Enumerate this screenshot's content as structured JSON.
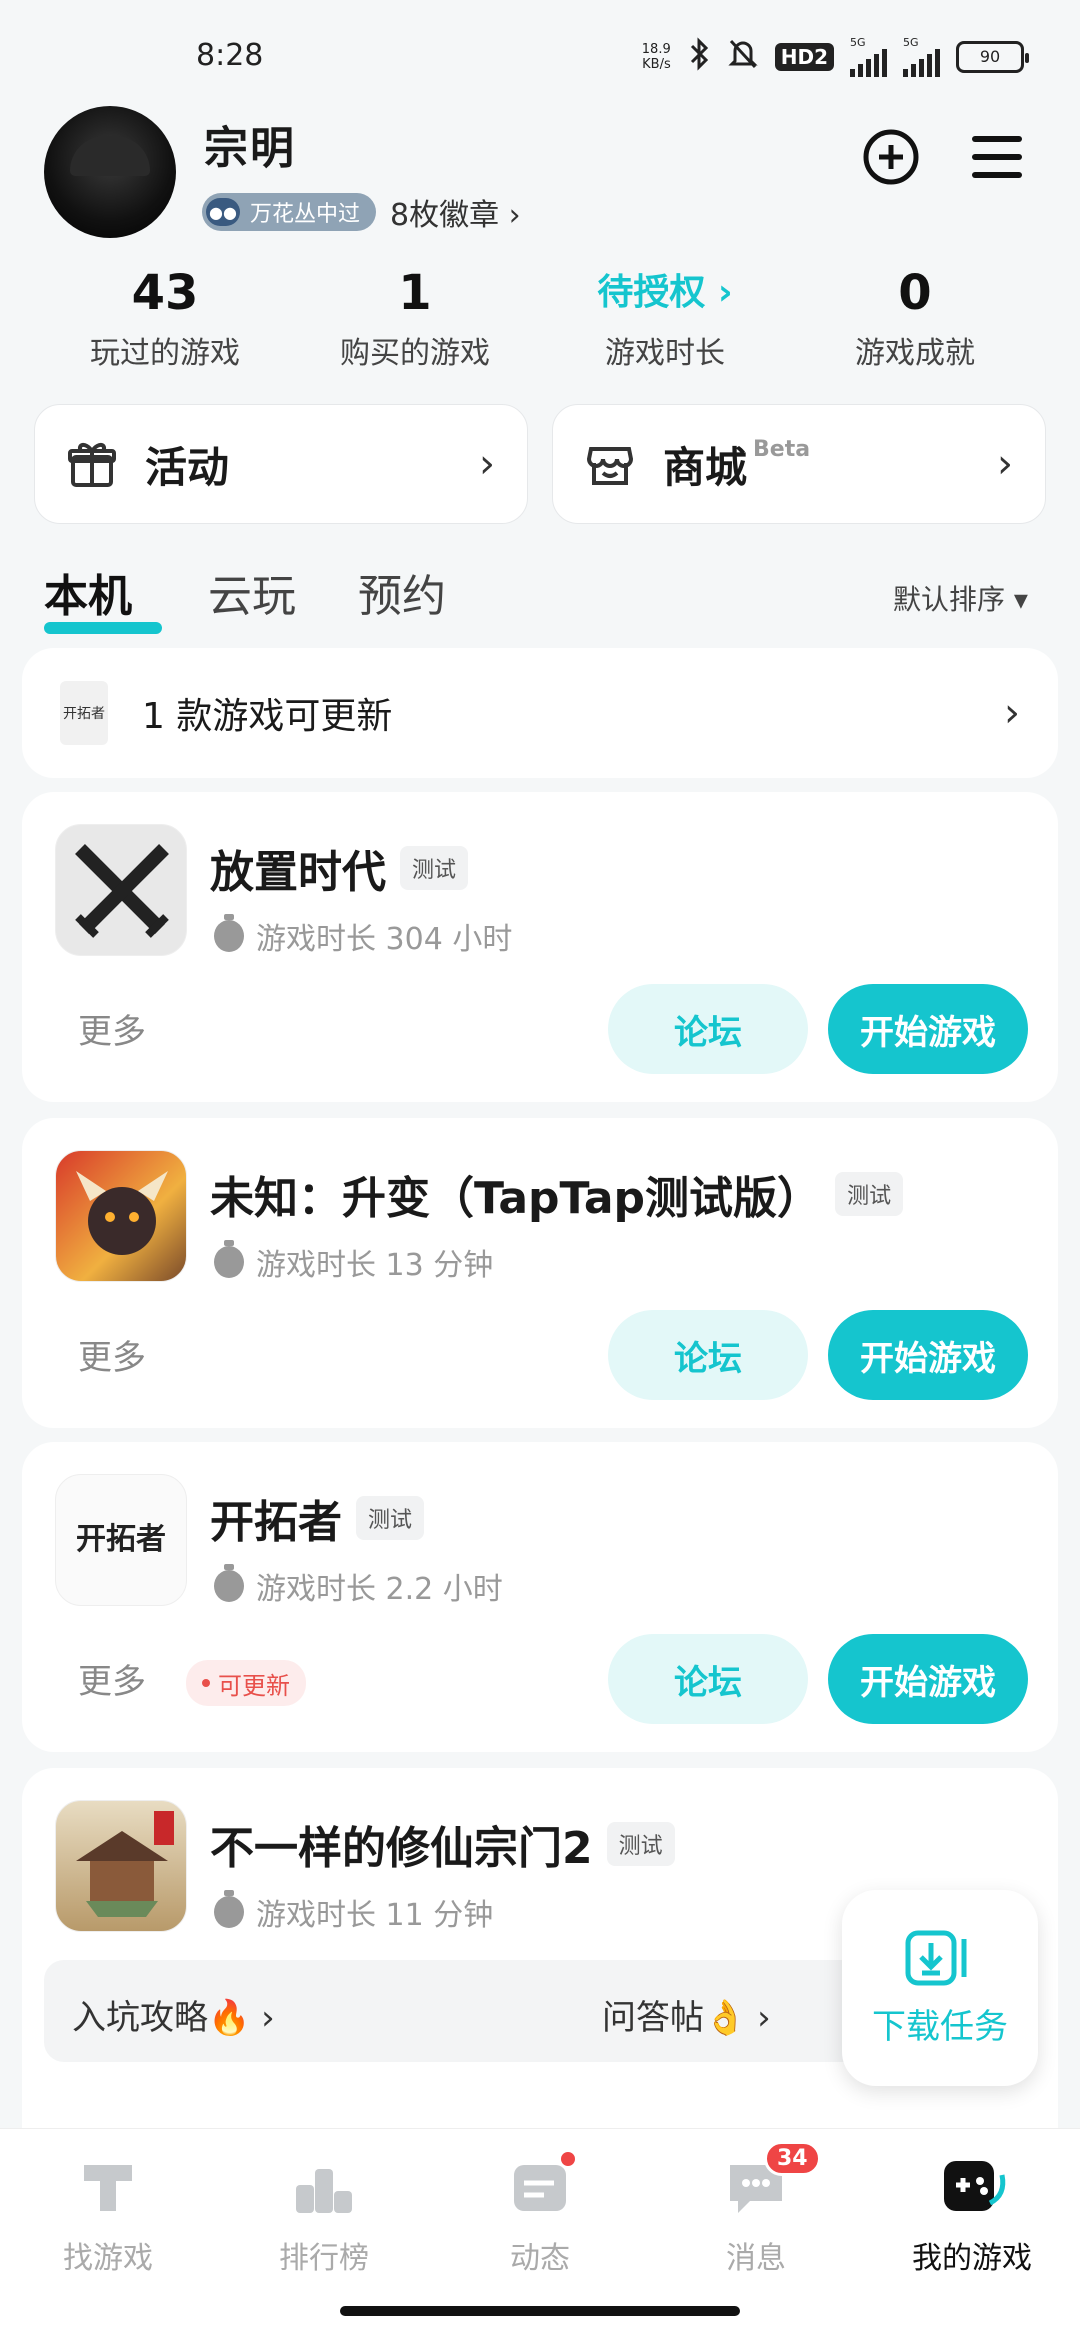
{
  "status": {
    "time": "8:28",
    "net_speed_value": "18.9",
    "net_speed_unit": "KB/s",
    "hd": "HD2",
    "signal_1": "5G",
    "signal_2": "5G",
    "battery": "90"
  },
  "profile": {
    "name": "宗明",
    "badge_title": "万花丛中过",
    "badge_count": "8枚徽章 ›"
  },
  "stats": [
    {
      "value": "43",
      "label": "玩过的游戏"
    },
    {
      "value": "1",
      "label": "购买的游戏"
    },
    {
      "value": "待授权 ›",
      "label": "游戏时长"
    },
    {
      "value": "0",
      "label": "游戏成就"
    }
  ],
  "entries": {
    "activity": "活动",
    "store": "商城",
    "store_sup": "Beta"
  },
  "tabs": {
    "local": "本机",
    "cloud": "云玩",
    "reserve": "预约",
    "sort": "默认排序 ▾"
  },
  "update_banner": {
    "icon_text": "开拓者",
    "text": "1 款游戏可更新"
  },
  "games": [
    {
      "title": "放置时代",
      "tag": "测试",
      "playtime": "游戏时长 304 小时",
      "more": "更多",
      "forum": "论坛",
      "play": "开始游戏"
    },
    {
      "title": "未知：升变（TapTap测试版）",
      "tag": "测试",
      "playtime": "游戏时长 13 分钟",
      "more": "更多",
      "forum": "论坛",
      "play": "开始游戏"
    },
    {
      "title": "开拓者",
      "tag": "测试",
      "playtime": "游戏时长 2.2 小时",
      "more": "更多",
      "updatable": "可更新",
      "forum": "论坛",
      "play": "开始游戏",
      "icon_text": "开拓者"
    },
    {
      "title": "不一样的修仙宗门2",
      "tag": "测试",
      "playtime": "游戏时长 11 分钟",
      "guide": "入坑攻略🔥 ›",
      "qa": "问答帖👌 ›"
    }
  ],
  "fab": {
    "label": "下载任务"
  },
  "nav": [
    {
      "label": "找游戏"
    },
    {
      "label": "排行榜"
    },
    {
      "label": "动态"
    },
    {
      "label": "消息",
      "badge": "34"
    },
    {
      "label": "我的游戏"
    }
  ],
  "colors": {
    "accent": "#15c5ce",
    "accent_light": "#e3f8f8",
    "badge_red": "#ef4545"
  }
}
